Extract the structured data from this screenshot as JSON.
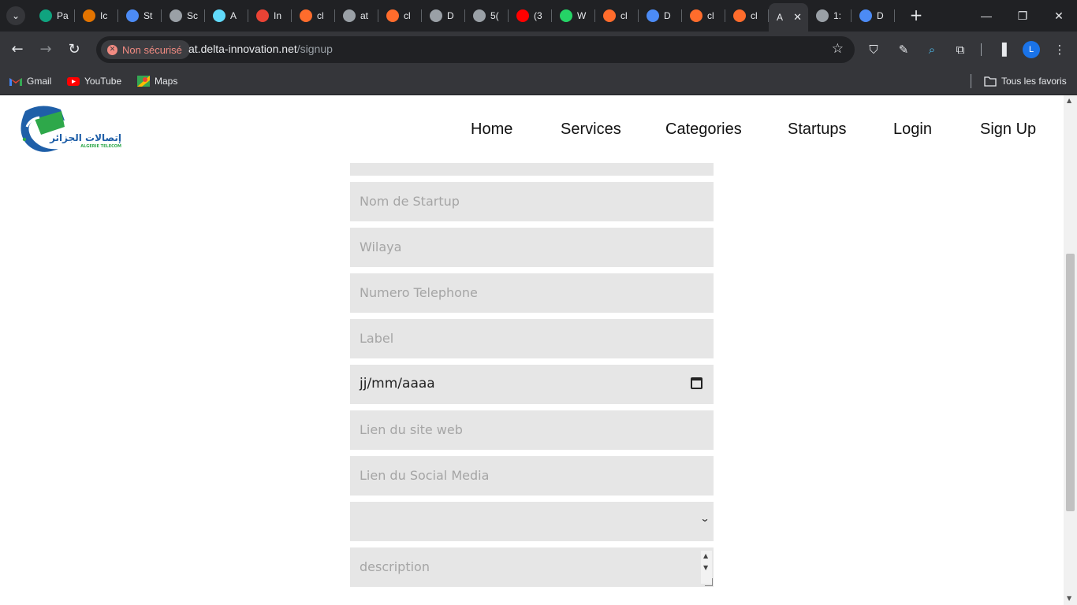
{
  "browser": {
    "tabs": [
      {
        "label": "Pa",
        "icon": "openai-icon",
        "color": "#10a37f"
      },
      {
        "label": "Ic",
        "icon": "barcode-icon",
        "color": "#e37400"
      },
      {
        "label": "St",
        "icon": "stack-icon",
        "color": "#4c8bf5"
      },
      {
        "label": "Sc",
        "icon": "globe-icon",
        "color": "#9aa0a6"
      },
      {
        "label": "A",
        "icon": "react-icon",
        "color": "#61dafb"
      },
      {
        "label": "In",
        "icon": "gmail-icon",
        "color": "#ea4335"
      },
      {
        "label": "cl",
        "icon": "cpanel-icon",
        "color": "#ff6c2c"
      },
      {
        "label": "at",
        "icon": "globe-icon",
        "color": "#9aa0a6"
      },
      {
        "label": "cl",
        "icon": "cpanel-icon",
        "color": "#ff6c2c"
      },
      {
        "label": "D",
        "icon": "globe-icon",
        "color": "#9aa0a6"
      },
      {
        "label": "5(",
        "icon": "globe-icon",
        "color": "#9aa0a6"
      },
      {
        "label": "(3",
        "icon": "youtube-icon",
        "color": "#ff0000"
      },
      {
        "label": "W",
        "icon": "whatsapp-icon",
        "color": "#25d366"
      },
      {
        "label": "cl",
        "icon": "cpanel-icon",
        "color": "#ff6c2c"
      },
      {
        "label": "D",
        "icon": "stack-icon",
        "color": "#4c8bf5"
      },
      {
        "label": "cl",
        "icon": "cpanel-icon",
        "color": "#ff6c2c"
      },
      {
        "label": "cl",
        "icon": "cpanel-icon",
        "color": "#ff6c2c"
      },
      {
        "label": "A",
        "icon": "none",
        "color": "#35363a",
        "active": true
      },
      {
        "label": "1:",
        "icon": "globe-icon",
        "color": "#9aa0a6"
      },
      {
        "label": "D",
        "icon": "stack-icon",
        "color": "#4c8bf5"
      }
    ],
    "security_label": "Non sécurisé",
    "url_host": "at.delta-innovation.net",
    "url_path": "/signup",
    "profile_initial": "L",
    "bookmarks": [
      {
        "label": "Gmail",
        "icon": "gmail-icon"
      },
      {
        "label": "YouTube",
        "icon": "youtube-icon"
      },
      {
        "label": "Maps",
        "icon": "maps-icon"
      }
    ],
    "all_bookmarks_label": "Tous les favoris"
  },
  "site": {
    "nav": [
      "Home",
      "Services",
      "Categories",
      "Startups",
      "Login",
      "Sign Up"
    ],
    "logo_text_ar": "إتصالات الجزائر",
    "logo_text_en": "ALGERIE TELECOM"
  },
  "form": {
    "startup_name_placeholder": "Nom de Startup",
    "wilaya_placeholder": "Wilaya",
    "phone_placeholder": "Numero Telephone",
    "label_placeholder": "Label",
    "date_value": "jj/mm/aaaa",
    "website_placeholder": "Lien du site web",
    "social_placeholder": "Lien du Social Media",
    "category_value": "",
    "description_placeholder": "description"
  },
  "colors": {
    "field_bg": "#e6e6e6",
    "placeholder": "#a5a5a5",
    "logo_blue": "#1f5fa8",
    "logo_green": "#2ea84a"
  }
}
